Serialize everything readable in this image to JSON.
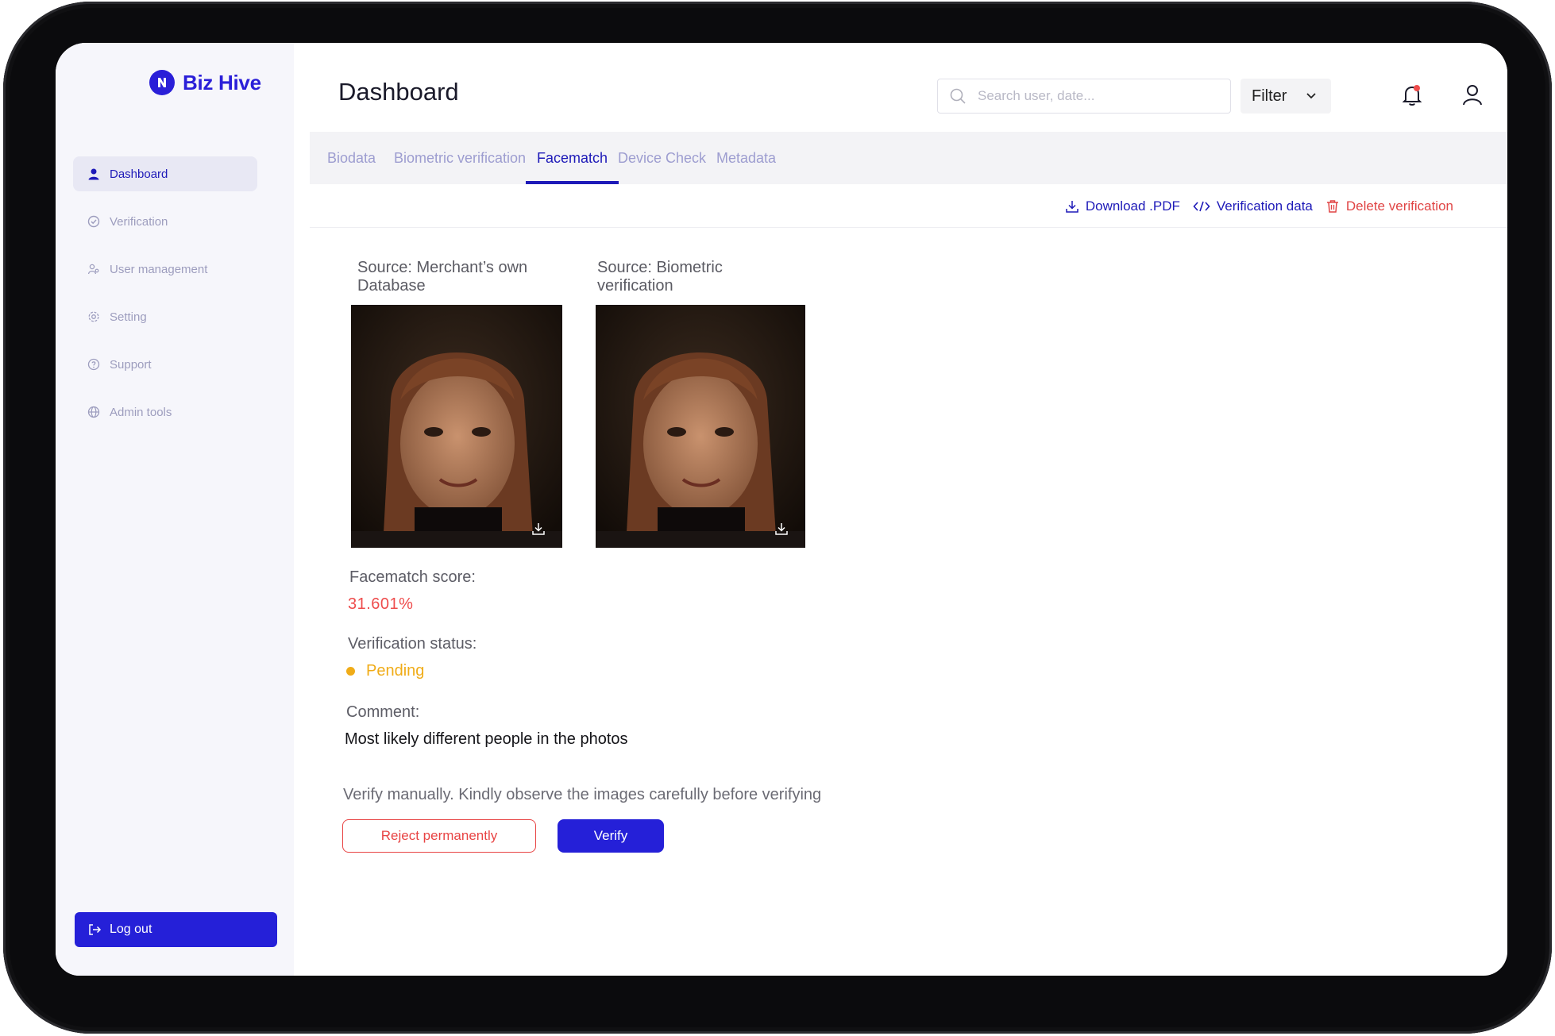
{
  "brand": {
    "name": "Biz Hive"
  },
  "sidebar": {
    "items": [
      {
        "label": "Dashboard",
        "icon": "person-icon",
        "active": true
      },
      {
        "label": "Verification",
        "icon": "check-circle-icon"
      },
      {
        "label": "User management",
        "icon": "users-icon"
      },
      {
        "label": "Setting",
        "icon": "gear-icon"
      },
      {
        "label": "Support",
        "icon": "question-circle-icon"
      },
      {
        "label": "Admin tools",
        "icon": "globe-icon"
      }
    ],
    "logout_label": "Log out"
  },
  "header": {
    "title": "Dashboard",
    "search_placeholder": "Search user, date...",
    "filter_label": "Filter"
  },
  "tabs": [
    {
      "label": "Biodata"
    },
    {
      "label": "Biometric verification"
    },
    {
      "label": "Facematch",
      "active": true
    },
    {
      "label": "Device Check"
    },
    {
      "label": "Metadata"
    }
  ],
  "actions": {
    "download": "Download .PDF",
    "verification_data": "Verification data",
    "delete": "Delete verification"
  },
  "photos": {
    "source1": "Source: Merchant’s own Database",
    "source2": "Source: Biometric verification"
  },
  "result": {
    "score_label": "Facematch score:",
    "score_value": "31.601%",
    "status_label": "Verification status:",
    "status_value": "Pending",
    "comment_label": "Comment:",
    "comment_value": "Most likely different people in the photos"
  },
  "manual": {
    "hint": "Verify manually. Kindly observe the images carefully before verifying",
    "reject_label": "Reject permanently",
    "verify_label": "Verify"
  },
  "colors": {
    "brand": "#2a1fd8",
    "danger": "#e84444",
    "pending": "#f0ac18"
  }
}
